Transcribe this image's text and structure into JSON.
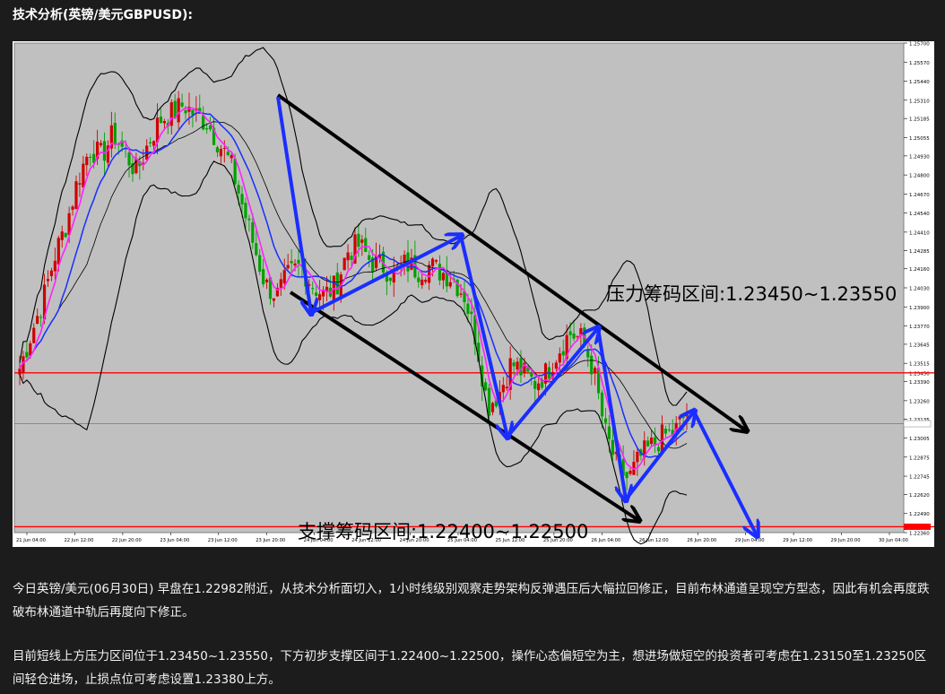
{
  "heading": "技术分析(英镑/美元GBPUSD):",
  "chart_data": {
    "type": "candlestick",
    "symbol": "GBPUSD",
    "timeframe": "H1",
    "ylim": [
      1.2236,
      1.257
    ],
    "y_ticks": [
      "1.25700",
      "1.25570",
      "1.25440",
      "1.25310",
      "1.25185",
      "1.25055",
      "1.24930",
      "1.24800",
      "1.24670",
      "1.24540",
      "1.24410",
      "1.24285",
      "1.24160",
      "1.24030",
      "1.23900",
      "1.23770",
      "1.23645",
      "1.23515",
      "1.23450",
      "1.23390",
      "1.23260",
      "1.23135",
      "1.23103",
      "1.23005",
      "1.22875",
      "1.22745",
      "1.22620",
      "1.22490",
      "1.22400",
      "1.22360"
    ],
    "x_ticks": [
      "21 Jun 04:00",
      "22 Jun 12:00",
      "22 Jun 20:00",
      "23 Jun 04:00",
      "23 Jun 12:00",
      "23 Jun 20:00",
      "24 Jun 04:00",
      "24 Jun 12:00",
      "24 Jun 20:00",
      "25 Jun 04:00",
      "25 Jun 12:00",
      "25 Jun 20:00",
      "26 Jun 04:00",
      "26 Jun 12:00",
      "26 Jun 20:00",
      "29 Jun 04:00",
      "29 Jun 12:00",
      "29 Jun 20:00",
      "30 Jun 04:00"
    ],
    "close_path": [
      1.2348,
      1.2372,
      1.2395,
      1.2425,
      1.2447,
      1.2478,
      1.2498,
      1.2493,
      1.2508,
      1.2495,
      1.2482,
      1.2502,
      1.2518,
      1.2522,
      1.2528,
      1.2521,
      1.2516,
      1.2502,
      1.2488,
      1.246,
      1.2432,
      1.2405,
      1.2398,
      1.2412,
      1.2418,
      1.2405,
      1.2398,
      1.2404,
      1.2428,
      1.2432,
      1.2421,
      1.2418,
      1.2412,
      1.242,
      1.2415,
      1.2418,
      1.2414,
      1.241,
      1.2398,
      1.2368,
      1.2322,
      1.2332,
      1.2352,
      1.2345,
      1.2338,
      1.2345,
      1.236,
      1.2372,
      1.2368,
      1.2348,
      1.2305,
      1.2282,
      1.2272,
      1.2287,
      1.2295,
      1.2302,
      1.2305,
      1.2318
    ],
    "current_price_line": 1.23103,
    "resistance_line": 1.2345,
    "support_line": 1.224,
    "annotations": {
      "resistance": "压力筹码区间:1.23450~1.23550",
      "support": "支撑筹码区间:1.22400~1.22500"
    },
    "overlays": [
      "bollinger-bands",
      "moving-average-blue",
      "moving-average-magenta",
      "descending-channel",
      "wave-path-arrows"
    ],
    "colors": {
      "background": "#c0c0c0",
      "up_candle": "#d00000",
      "down_candle": "#00a000",
      "ma_fast": "#ff22ff",
      "ma_slow": "#1a2eff",
      "bands": "#000000",
      "channel": "#000000",
      "arrows": "#1a2eff",
      "horizontal_red": "#ff0000"
    }
  },
  "paragraphs": [
    "今日英镑/美元(06月30日) 早盘在1.22982附近，从技术分析面切入，1小时线级别观察走势架构反弹遇压后大幅拉回修正，目前布林通道呈现空方型态，因此有机会再度跌破布林通道中轨后再度向下修正。",
    "目前短线上方压力区间位于1.23450~1.23550，下方初步支撑区间于1.22400~1.22500，操作心态偏短空为主，想进场做短空的投资者可考虑在1.23150至1.23250区间轻仓进场，止损点位可考虑设置1.23380上方。"
  ]
}
